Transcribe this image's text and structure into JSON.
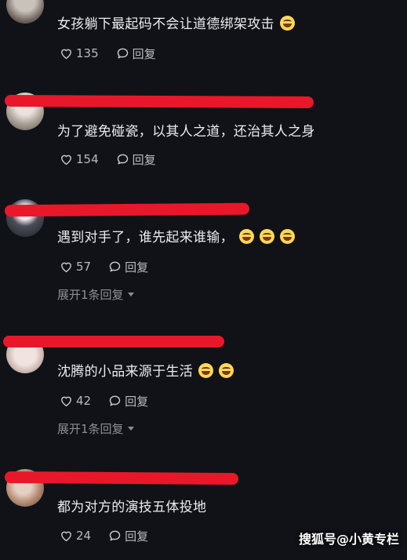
{
  "comments": [
    {
      "text": "女孩躺下最起码不会让道德绑架攻击",
      "likes": "135",
      "reply_label": "回复",
      "ghost_name": ""
    },
    {
      "text": "为了避免碰瓷，以其人之道，还治其人之身",
      "likes": "154",
      "reply_label": "回复"
    },
    {
      "text": "遇到对手了，谁先起来谁输，",
      "likes": "57",
      "reply_label": "回复",
      "expand_label": "展开1条回复"
    },
    {
      "text": "沈腾的小品来源于生活",
      "likes": "42",
      "reply_label": "回复",
      "expand_label": "展开1条回复"
    },
    {
      "text": "都为对方的演技五体投地",
      "likes": "24",
      "reply_label": "回复"
    }
  ],
  "watermark": "搜狐号@小黄专栏",
  "colors": {
    "background": "#111217",
    "redacted_mark": "#e8182a",
    "text": "#ececee",
    "secondary": "#b9babf"
  }
}
